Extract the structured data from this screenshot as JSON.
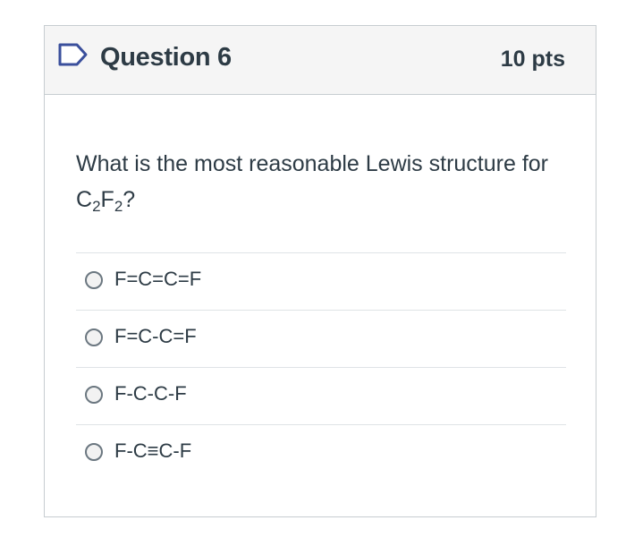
{
  "question": {
    "title": "Question 6",
    "points": "10 pts",
    "text_prefix": "What is the most reasonable Lewis structure for C",
    "sub1": "2",
    "mid": "F",
    "sub2": "2",
    "text_suffix": "?"
  },
  "answers": [
    {
      "label": "F=C=C=F"
    },
    {
      "label": "F=C-C=F"
    },
    {
      "label": "F-C-C-F"
    },
    {
      "label": "F-C≡C-F"
    }
  ],
  "colors": {
    "header_bg": "#f5f5f5",
    "border": "#c7cdd1",
    "text": "#2d3b45",
    "icon_stroke": "#3a4f9c"
  },
  "icons": {
    "flag": "bookmark-flag-icon",
    "radio": "radio-unselected-icon"
  }
}
